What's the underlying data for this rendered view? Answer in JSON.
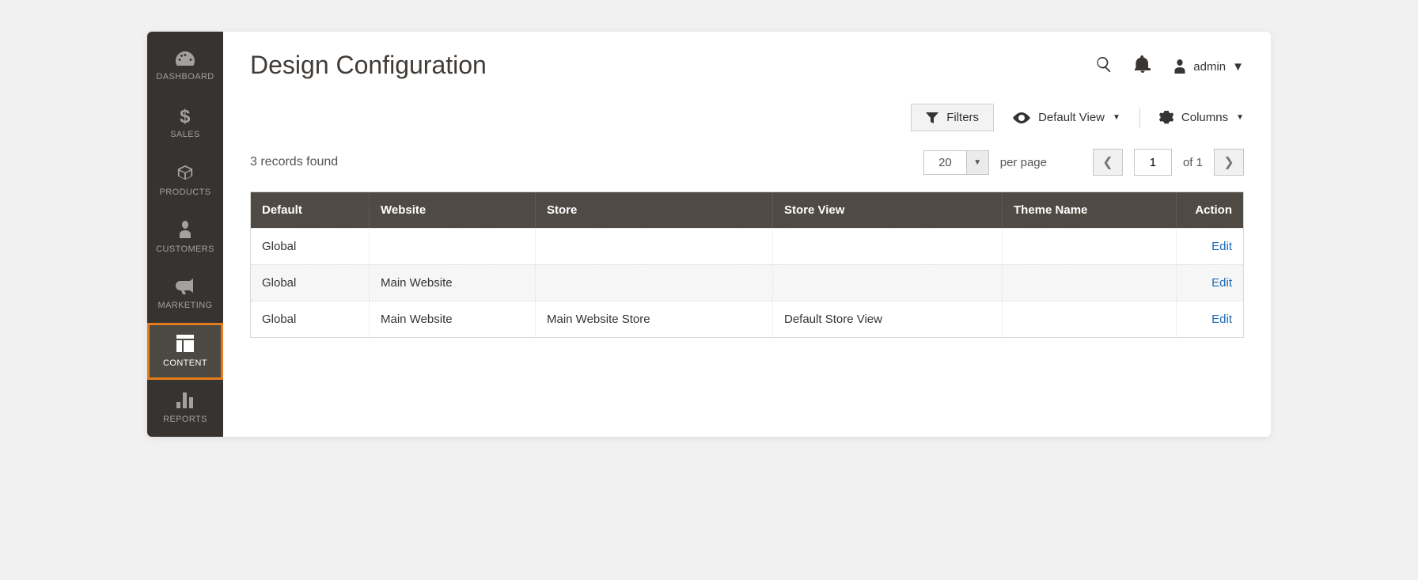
{
  "sidebar": {
    "items": [
      {
        "label": "DASHBOARD",
        "icon": "dashboard-icon"
      },
      {
        "label": "SALES",
        "icon": "dollar-icon"
      },
      {
        "label": "PRODUCTS",
        "icon": "box-icon"
      },
      {
        "label": "CUSTOMERS",
        "icon": "person-icon"
      },
      {
        "label": "MARKETING",
        "icon": "megaphone-icon"
      },
      {
        "label": "CONTENT",
        "icon": "layout-icon"
      },
      {
        "label": "REPORTS",
        "icon": "bar-chart-icon"
      }
    ],
    "active_index": 5
  },
  "header": {
    "title": "Design Configuration",
    "user_label": "admin"
  },
  "toolbar": {
    "filters_label": "Filters",
    "default_view_label": "Default View",
    "columns_label": "Columns"
  },
  "grid_controls": {
    "records_found_text": "3 records found",
    "per_page_value": "20",
    "per_page_label": "per page",
    "current_page": "1",
    "total_pages_text": "of 1"
  },
  "table": {
    "columns": {
      "default": "Default",
      "website": "Website",
      "store": "Store",
      "store_view": "Store View",
      "theme_name": "Theme Name",
      "action": "Action"
    },
    "edit_label": "Edit",
    "rows": [
      {
        "default": "Global",
        "website": "",
        "store": "",
        "store_view": "",
        "theme_name": ""
      },
      {
        "default": "Global",
        "website": "Main Website",
        "store": "",
        "store_view": "",
        "theme_name": ""
      },
      {
        "default": "Global",
        "website": "Main Website",
        "store": "Main Website Store",
        "store_view": "Default Store View",
        "theme_name": ""
      }
    ]
  }
}
